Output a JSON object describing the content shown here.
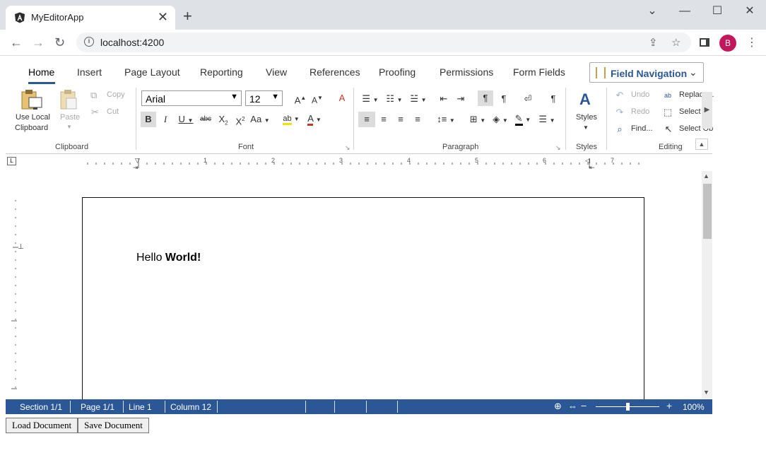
{
  "browser": {
    "tab_title": "MyEditorApp",
    "tab_close": "✕",
    "new_tab": "+",
    "url": "localhost:4200",
    "avatar_letter": "B",
    "window_controls": [
      "⌄",
      "—",
      "☐",
      "✕"
    ]
  },
  "ribbon": {
    "tabs": [
      "Home",
      "Insert",
      "Page Layout",
      "Reporting",
      "View",
      "References",
      "Proofing",
      "Permissions",
      "Form Fields"
    ],
    "active_tab": "Home",
    "field_navigation": "Field Navigation",
    "clipboard": {
      "use_local": "Use Local",
      "clipboard": "Clipboard",
      "paste": "Paste",
      "copy": "Copy",
      "cut": "Cut",
      "group": "Clipboard"
    },
    "font": {
      "family": "Arial",
      "size": "12",
      "group": "Font"
    },
    "paragraph": {
      "group": "Paragraph"
    },
    "styles": {
      "label": "Styles",
      "group": "Styles"
    },
    "editing": {
      "undo": "Undo",
      "redo": "Redo",
      "find": "Find...",
      "replace": "Replace...",
      "select_all": "Select",
      "select_objects": "Select Ob",
      "group": "Editing"
    }
  },
  "ruler": {
    "numbers": [
      "1",
      "2",
      "3",
      "4",
      "5",
      "6",
      "7"
    ]
  },
  "document": {
    "text_normal": "Hello ",
    "text_bold": "World!"
  },
  "status": {
    "section": "Section 1/1",
    "page": "Page 1/1",
    "line": "Line 1",
    "column": "Column 12",
    "zoom": "100%",
    "zoom_level": 0.5
  },
  "buttons": {
    "load": "Load Document",
    "save": "Save Document"
  }
}
